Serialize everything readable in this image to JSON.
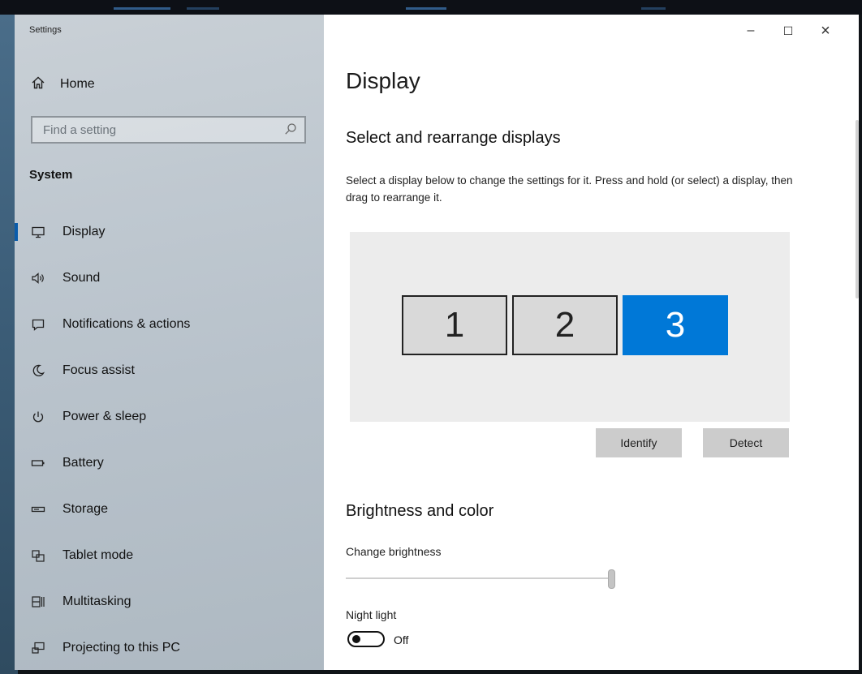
{
  "window": {
    "title": "Settings"
  },
  "window_controls": {
    "minimize": "–",
    "maximize": "☐",
    "close": "×"
  },
  "sidebar": {
    "home_label": "Home",
    "search_placeholder": "Find a setting",
    "section_label": "System",
    "items": [
      {
        "label": "Display",
        "icon": "monitor-icon",
        "active": true
      },
      {
        "label": "Sound",
        "icon": "speaker-icon"
      },
      {
        "label": "Notifications & actions",
        "icon": "notification-icon"
      },
      {
        "label": "Focus assist",
        "icon": "moon-icon"
      },
      {
        "label": "Power & sleep",
        "icon": "power-icon"
      },
      {
        "label": "Battery",
        "icon": "battery-icon"
      },
      {
        "label": "Storage",
        "icon": "storage-icon"
      },
      {
        "label": "Tablet mode",
        "icon": "tablet-mode-icon"
      },
      {
        "label": "Multitasking",
        "icon": "multitasking-icon"
      },
      {
        "label": "Projecting to this PC",
        "icon": "projecting-icon"
      }
    ]
  },
  "main": {
    "title": "Display",
    "arrange_heading": "Select and rearrange displays",
    "arrange_description": "Select a display below to change the settings for it. Press and hold (or select) a display, then drag to rearrange it.",
    "monitors": [
      {
        "label": "1",
        "selected": false
      },
      {
        "label": "2",
        "selected": false
      },
      {
        "label": "3",
        "selected": true
      }
    ],
    "identify_label": "Identify",
    "detect_label": "Detect",
    "brightness_heading": "Brightness and color",
    "brightness_label": "Change brightness",
    "brightness_value": 1.0,
    "night_light_label": "Night light",
    "night_light_state": "Off"
  },
  "colors": {
    "accent": "#0078d7",
    "active_indicator": "#0a5cab"
  }
}
